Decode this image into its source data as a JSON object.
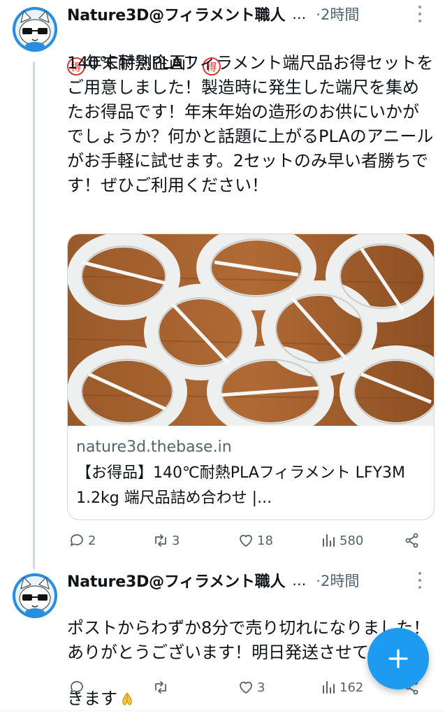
{
  "thread": [
    {
      "author": "Nature3D@フィラメント職人",
      "ellipsis": "…",
      "time": "·2時間",
      "badge_left": "㊙",
      "text_lines": "年末特別企画！",
      "body": "140℃耐熱PLAフィラメント端尺品お得セットをご用意しました！製造時に発生した端尺を集めたお得品です！年末年始の造形のお供にいかがでしょうか？何かと話題に上がるPLAのアニールがお手軽に試せます。2セットのみ早い者勝ちです！ぜひご利用ください！",
      "card": {
        "domain": "nature3d.thebase.in",
        "title": "【お得品】140℃耐熱PLAフィラメント LFY3M 1.2kg 端尺品詰め合わせ |..."
      },
      "actions": {
        "replies": "2",
        "reposts": "3",
        "likes": "18",
        "views": "580"
      }
    },
    {
      "author": "Nature3D@フィラメント職人",
      "ellipsis": "…",
      "time": "·2時間",
      "body": "ポストからわずか8分で売り切れになりました！ありがとうございます！明日発送させていただきます",
      "emoji_name": "folded-hands-emoji",
      "actions": {
        "replies": "",
        "reposts": "",
        "likes": "3",
        "views": "162"
      }
    }
  ],
  "colors": {
    "accent": "#1d9bf0",
    "muted": "#536471",
    "text": "#0f1419",
    "border": "#cfd9de"
  },
  "fab_icon": "plus-icon"
}
